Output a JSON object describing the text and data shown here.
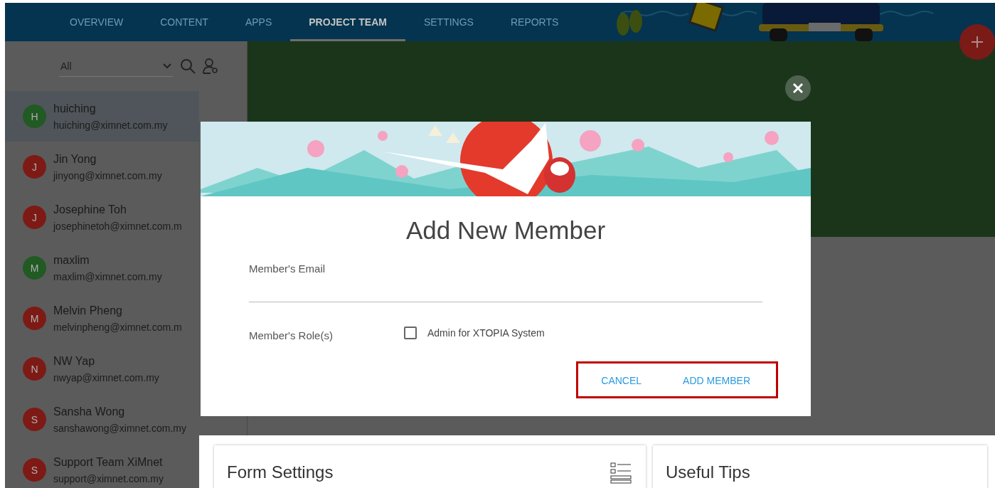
{
  "tabs": [
    {
      "label": "OVERVIEW",
      "selected": false
    },
    {
      "label": "CONTENT",
      "selected": false
    },
    {
      "label": "APPS",
      "selected": false
    },
    {
      "label": "PROJECT TEAM",
      "selected": true
    },
    {
      "label": "SETTINGS",
      "selected": false
    },
    {
      "label": "REPORTS",
      "selected": false
    }
  ],
  "sidebar": {
    "filter": {
      "value": "All"
    },
    "members": [
      {
        "initial": "H",
        "name": "huiching",
        "email": "huiching@ximnet.com.my",
        "color": "#215a22",
        "selected": true
      },
      {
        "initial": "J",
        "name": "Jin Yong",
        "email": "jinyong@ximnet.com.my",
        "color": "#7e1a15",
        "selected": false
      },
      {
        "initial": "J",
        "name": "Josephine Toh",
        "email": "josephinetoh@ximnet.com.m",
        "color": "#7e1a15",
        "selected": false
      },
      {
        "initial": "M",
        "name": "maxlim",
        "email": "maxlim@ximnet.com.my",
        "color": "#215a22",
        "selected": false
      },
      {
        "initial": "M",
        "name": "Melvin Pheng",
        "email": "melvinpheng@ximnet.com.m",
        "color": "#7e1a15",
        "selected": false
      },
      {
        "initial": "N",
        "name": "NW Yap",
        "email": "nwyap@ximnet.com.my",
        "color": "#7e1a15",
        "selected": false
      },
      {
        "initial": "S",
        "name": "Sansha Wong",
        "email": "sanshawong@ximnet.com.my",
        "color": "#7e1a15",
        "selected": false
      },
      {
        "initial": "S",
        "name": "Support Team XiMnet",
        "email": "support@ximnet.com.my",
        "color": "#7e1a15",
        "selected": false
      }
    ]
  },
  "dialog": {
    "title": "Add New Member",
    "email_label": "Member's Email",
    "role_label": "Member's Role(s)",
    "role_option": {
      "label": "Admin for XTOPIA System",
      "checked": false
    },
    "buttons": [
      "CANCEL",
      "ADD MEMBER"
    ]
  },
  "cards": [
    {
      "title": "Form Settings"
    },
    {
      "title": "Useful Tips"
    }
  ]
}
